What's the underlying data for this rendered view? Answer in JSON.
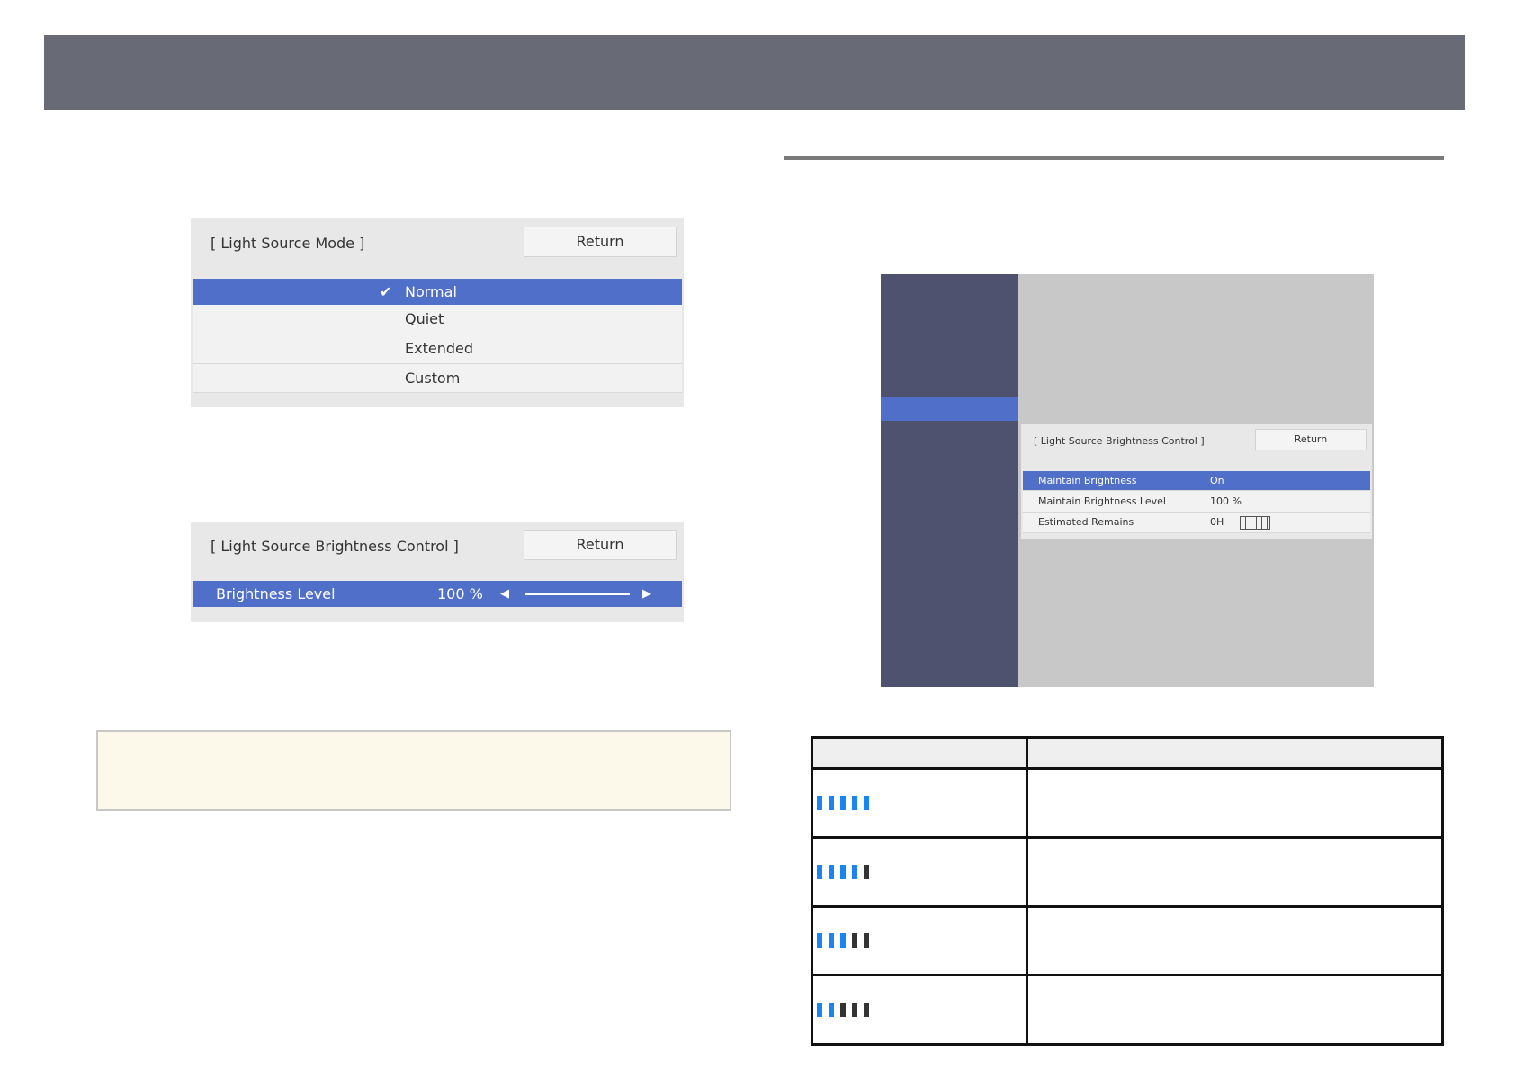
{
  "mode_panel": {
    "title": "[ Light Source Mode ]",
    "return_label": "Return",
    "options": [
      {
        "label": "Normal",
        "selected": true
      },
      {
        "label": "Quiet"
      },
      {
        "label": "Extended"
      },
      {
        "label": "Custom"
      }
    ]
  },
  "brightness_panel": {
    "title": "[ Light Source Brightness Control ]",
    "return_label": "Return",
    "row_label": "Brightness Level",
    "value": "100 %",
    "slider_percent": 100
  },
  "screen": {
    "title": "[ Light Source Brightness Control ]",
    "return_label": "Return",
    "rows": [
      {
        "label": "Maintain Brightness",
        "value": "On"
      },
      {
        "label": "Maintain Brightness Level",
        "value": "100 %"
      },
      {
        "label": "Estimated Remains",
        "value": "0H"
      }
    ]
  },
  "table": {
    "rows": [
      {
        "filled": 5
      },
      {
        "filled": 4
      },
      {
        "filled": 3
      },
      {
        "filled": 2
      }
    ],
    "colors": {
      "filled": "#1a85f0",
      "empty": "#333333"
    }
  }
}
